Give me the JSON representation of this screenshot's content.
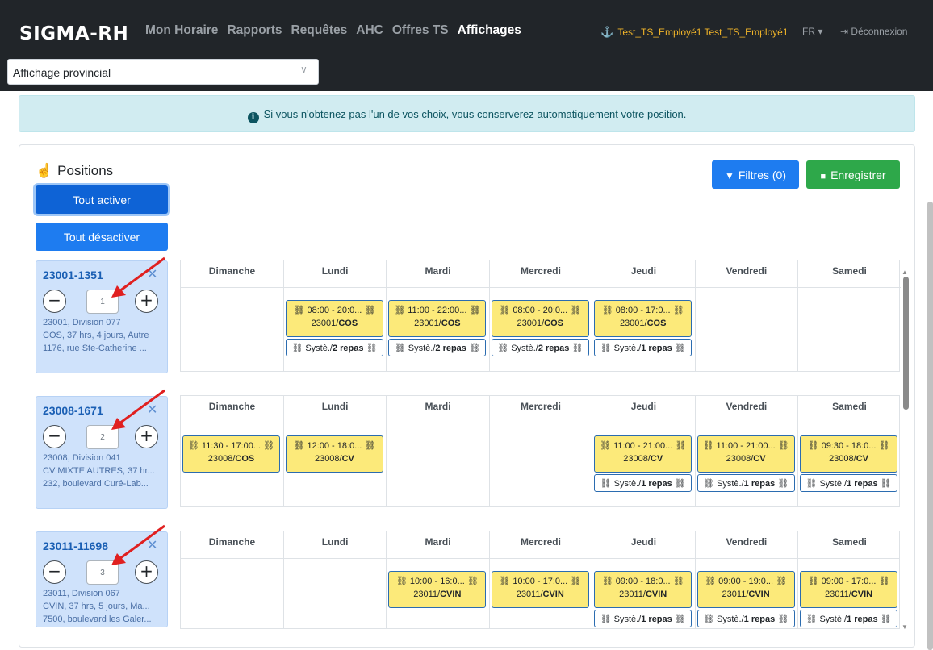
{
  "app": {
    "logo": "SIGMA-RH"
  },
  "nav": {
    "items": [
      "Mon Horaire",
      "Rapports",
      "Requêtes",
      "AHC",
      "Offres TS",
      "Affichages"
    ],
    "active_index": 5,
    "user": "Test_TS_Employé1 Test_TS_Employé1",
    "lang": "FR ▾",
    "logout": "Déconnexion"
  },
  "select": {
    "value": "Affichage provincial"
  },
  "alert": {
    "text": "Si vous n'obtenez pas l'un de vos choix, vous conserverez automatiquement votre position."
  },
  "section": {
    "title": "Positions"
  },
  "buttons": {
    "activate_all": "Tout activer",
    "deactivate_all": "Tout désactiver",
    "filters": "Filtres (0)",
    "save": "Enregistrer"
  },
  "colors": {
    "primary": "#1e7cf0",
    "success": "#2ea84a",
    "shift_bg": "#fcea7a",
    "panel_bg": "#cfe2fb",
    "arrow": "#e02020"
  },
  "days": [
    "Dimanche",
    "Lundi",
    "Mardi",
    "Mercredi",
    "Jeudi",
    "Vendredi",
    "Samedi"
  ],
  "positions": [
    {
      "code": "23001-1351",
      "priority": "1",
      "line1": "23001, Division 077",
      "line2": "COS, 37 hrs, 4 jours, Autre",
      "line3": "1176, rue Ste-Catherine ...",
      "shifts": [
        null,
        {
          "time": "08:00 - 20:0...",
          "code_pre": "23001/",
          "code_bold": "COS",
          "sys": "Systè./",
          "sys_bold": "2 repas"
        },
        {
          "time": "11:00 - 22:00...",
          "code_pre": "23001/",
          "code_bold": "COS",
          "sys": "Systè./",
          "sys_bold": "2 repas"
        },
        {
          "time": "08:00 - 20:0...",
          "code_pre": "23001/",
          "code_bold": "COS",
          "sys": "Systè./",
          "sys_bold": "2 repas"
        },
        {
          "time": "08:00 - 17:0...",
          "code_pre": "23001/",
          "code_bold": "COS",
          "sys": "Systè./",
          "sys_bold": "1 repas"
        },
        null,
        null
      ]
    },
    {
      "code": "23008-1671",
      "priority": "2",
      "line1": "23008, Division 041",
      "line2": "CV MIXTE AUTRES, 37 hr...",
      "line3": "232, boulevard Curé-Lab...",
      "shifts": [
        {
          "time": "11:30 - 17:00...",
          "code_pre": "23008/",
          "code_bold": "COS",
          "sys": null,
          "sys_bold": null
        },
        {
          "time": "12:00 - 18:0...",
          "code_pre": "23008/",
          "code_bold": "CV",
          "sys": null,
          "sys_bold": null
        },
        null,
        null,
        {
          "time": "11:00 - 21:00...",
          "code_pre": "23008/",
          "code_bold": "CV",
          "sys": "Systè./",
          "sys_bold": "1 repas"
        },
        {
          "time": "11:00 - 21:00...",
          "code_pre": "23008/",
          "code_bold": "CV",
          "sys": "Systè./",
          "sys_bold": "1 repas"
        },
        {
          "time": "09:30 - 18:0...",
          "code_pre": "23008/",
          "code_bold": "CV",
          "sys": "Systè./",
          "sys_bold": "1 repas"
        }
      ]
    },
    {
      "code": "23011-11698",
      "priority": "3",
      "line1": "23011, Division 067",
      "line2": "CVIN, 37 hrs, 5 jours, Ma...",
      "line3": "7500, boulevard les Galer...",
      "shifts": [
        null,
        null,
        {
          "time": "10:00 - 16:0...",
          "code_pre": "23011/",
          "code_bold": "CVIN",
          "sys": null,
          "sys_bold": null
        },
        {
          "time": "10:00 - 17:0...",
          "code_pre": "23011/",
          "code_bold": "CVIN",
          "sys": null,
          "sys_bold": null
        },
        {
          "time": "09:00 - 18:0...",
          "code_pre": "23011/",
          "code_bold": "CVIN",
          "sys": "Systè./",
          "sys_bold": "1 repas"
        },
        {
          "time": "09:00 - 19:0...",
          "code_pre": "23011/",
          "code_bold": "CVIN",
          "sys": "Systè./",
          "sys_bold": "1 repas"
        },
        {
          "time": "09:00 - 17:0...",
          "code_pre": "23011/",
          "code_bold": "CVIN",
          "sys": "Systè./",
          "sys_bold": "1 repas"
        }
      ]
    }
  ]
}
